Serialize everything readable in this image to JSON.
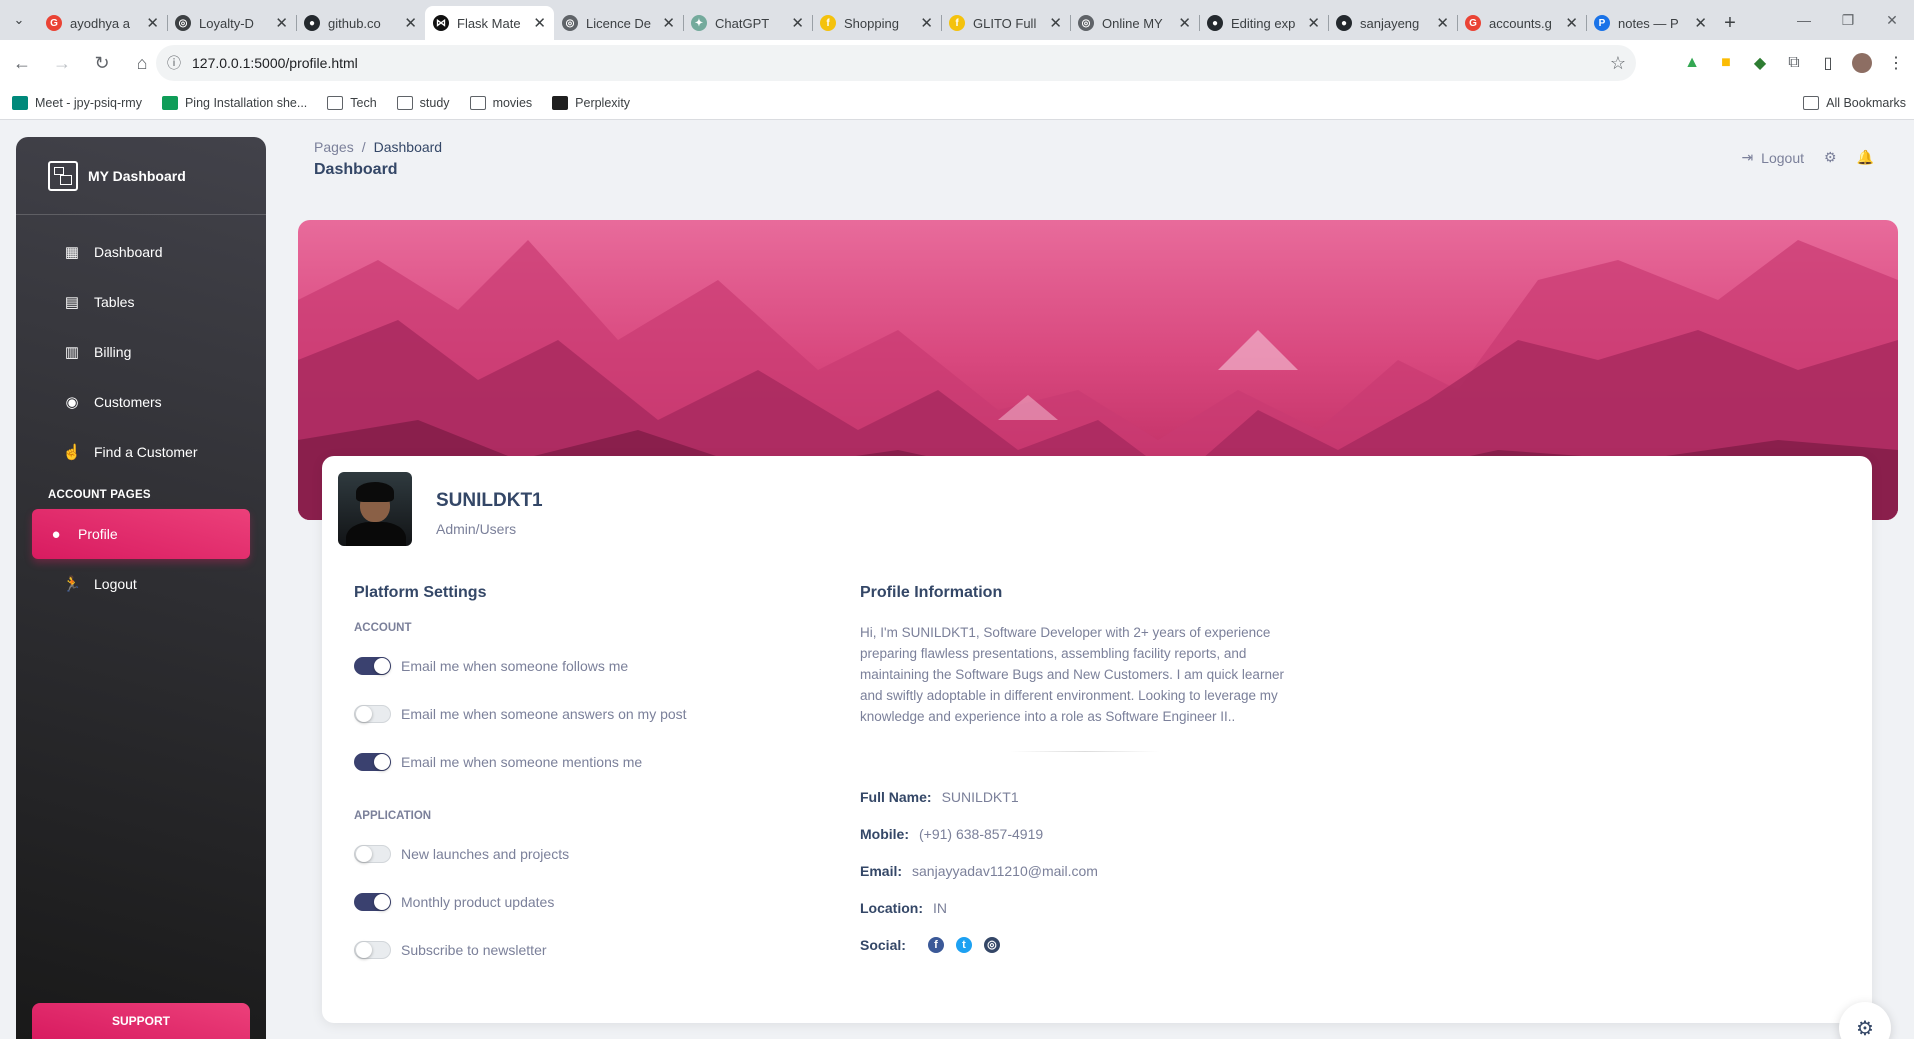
{
  "browser": {
    "tabs": [
      {
        "title": "ayodhya a",
        "color": "#ea4335",
        "glyph": "G"
      },
      {
        "title": "Loyalty-D",
        "color": "#3c4043",
        "glyph": "◎"
      },
      {
        "title": "github.co",
        "color": "#24292e",
        "glyph": "●"
      },
      {
        "title": "Flask Mate",
        "color": "#111111",
        "glyph": "⋈"
      },
      {
        "title": "Licence De",
        "color": "#5f6368",
        "glyph": "◎"
      },
      {
        "title": "ChatGPT",
        "color": "#74aa9c",
        "glyph": "✦"
      },
      {
        "title": "Shopping",
        "color": "#f4c20d",
        "glyph": "f"
      },
      {
        "title": "GLITO Full",
        "color": "#f4c20d",
        "glyph": "f"
      },
      {
        "title": "Online MY",
        "color": "#5f6368",
        "glyph": "◎"
      },
      {
        "title": "Editing exp",
        "color": "#24292e",
        "glyph": "●"
      },
      {
        "title": "sanjayeng",
        "color": "#24292e",
        "glyph": "●"
      },
      {
        "title": "accounts.g",
        "color": "#ea4335",
        "glyph": "G"
      },
      {
        "title": "notes — P",
        "color": "#1a73e8",
        "glyph": "P"
      }
    ],
    "active_tab_index": 3,
    "url": "127.0.0.1:5000/profile.html",
    "bookmarks": [
      {
        "label": "Meet - jpy-psiq-rmy",
        "icon": "meet-icon"
      },
      {
        "label": "Ping Installation she...",
        "icon": "sheets-icon"
      },
      {
        "label": "Tech",
        "icon": "folder-icon"
      },
      {
        "label": "study",
        "icon": "folder-icon"
      },
      {
        "label": "movies",
        "icon": "folder-icon"
      },
      {
        "label": "Perplexity",
        "icon": "perplexity-icon"
      }
    ],
    "all_bookmarks": "All Bookmarks"
  },
  "sidebar": {
    "brand": "MY Dashboard",
    "items": [
      {
        "label": "Dashboard",
        "icon": "dashboard-icon",
        "glyph": "▦"
      },
      {
        "label": "Tables",
        "icon": "tables-icon",
        "glyph": "▤"
      },
      {
        "label": "Billing",
        "icon": "billing-icon",
        "glyph": "▥"
      },
      {
        "label": "Customers",
        "icon": "customers-icon",
        "glyph": "◉"
      },
      {
        "label": "Find a Customer",
        "icon": "hand-icon",
        "glyph": "☝"
      }
    ],
    "section_label": "ACCOUNT PAGES",
    "account_items": [
      {
        "label": "Profile",
        "icon": "person-icon",
        "glyph": "●",
        "active": true
      },
      {
        "label": "Logout",
        "icon": "running-icon",
        "glyph": "🏃",
        "active": false
      }
    ],
    "support": "SUPPORT"
  },
  "header": {
    "breadcrumb_root": "Pages",
    "breadcrumb_separator": "/",
    "breadcrumb_current": "Dashboard",
    "title": "Dashboard",
    "logout": "Logout"
  },
  "profile": {
    "name": "SUNILDKT1",
    "role": "Admin/Users"
  },
  "platform_settings": {
    "title": "Platform Settings",
    "account_label": "ACCOUNT",
    "account": [
      {
        "label": "Email me when someone follows me",
        "on": true
      },
      {
        "label": "Email me when someone answers on my post",
        "on": false
      },
      {
        "label": "Email me when someone mentions me",
        "on": true
      }
    ],
    "application_label": "APPLICATION",
    "application": [
      {
        "label": "New launches and projects",
        "on": false
      },
      {
        "label": "Monthly product updates",
        "on": true
      },
      {
        "label": "Subscribe to newsletter",
        "on": false
      }
    ]
  },
  "profile_info": {
    "title": "Profile Information",
    "bio": "Hi, I'm SUNILDKT1, Software Developer with 2+ years of experience preparing flawless presentations, assembling facility reports, and maintaining the Software Bugs and New Customers. I am quick learner and swiftly adoptable in different environment. Looking to leverage my knowledge and experience into a role as Software Engineer II..",
    "fields": [
      {
        "key": "Full Name:",
        "value": "SUNILDKT1"
      },
      {
        "key": "Mobile:",
        "value": "(+91) 638-857-4919"
      },
      {
        "key": "Email:",
        "value": "sanjayyadav11210@mail.com"
      },
      {
        "key": "Location:",
        "value": "IN"
      }
    ],
    "social_label": "Social:",
    "social": [
      {
        "name": "facebook-icon",
        "glyph": "f",
        "color": "#3b5998"
      },
      {
        "name": "twitter-icon",
        "glyph": "t",
        "color": "#1da1f2"
      },
      {
        "name": "instagram-icon",
        "glyph": "◎",
        "color": "#344767"
      }
    ]
  },
  "colors": {
    "accent": "#e91e63",
    "sidebar_dark": "#191919",
    "switch_on": "#3a416f"
  }
}
